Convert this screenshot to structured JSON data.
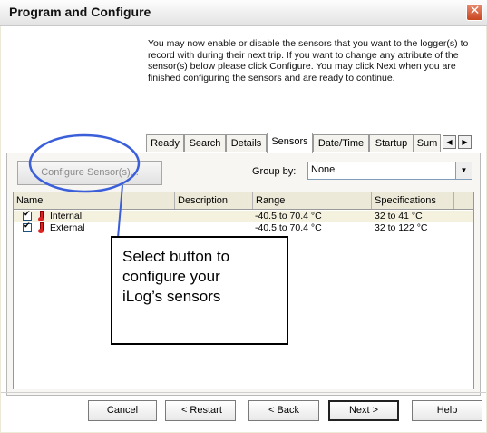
{
  "window": {
    "title": "Program and Configure",
    "close_glyph": "✕"
  },
  "intro_text": "You may now enable or disable the sensors that you want to the logger(s) to record with during their next trip. If you want to change any attribute of the sensor(s) below please click Configure. You may click Next when you are finished configuring the sensors and are ready to continue.",
  "tabs": [
    {
      "label": "Ready"
    },
    {
      "label": "Search"
    },
    {
      "label": "Details"
    },
    {
      "label": "Sensors",
      "active": true
    },
    {
      "label": "Date/Time"
    },
    {
      "label": "Startup"
    },
    {
      "label": "Sum"
    }
  ],
  "tab_scroll": {
    "left": "◀",
    "right": "▶"
  },
  "toolbar": {
    "configure_label": "Configure Sensor(s)...",
    "group_by_label": "Group by:",
    "group_by_value": "None",
    "dropdown_arrow": "▼"
  },
  "list": {
    "columns": [
      "Name",
      "Description",
      "Range",
      "Specifications"
    ],
    "rows": [
      {
        "checked": "✔",
        "name": "Internal",
        "description": "",
        "range": "-40.5 to 70.4 °C",
        "spec": "32 to 41 °C"
      },
      {
        "checked": "✔",
        "name": "External",
        "description": "",
        "range": "-40.5 to 70.4 °C",
        "spec": "32 to 122 °C"
      }
    ]
  },
  "callout": {
    "line1": "Select button to",
    "line2": "configure your",
    "line3": "iLog’s sensors"
  },
  "buttons": {
    "cancel": "Cancel",
    "restart": "|< Restart",
    "back": "< Back",
    "next": "Next >",
    "help": "Help"
  }
}
